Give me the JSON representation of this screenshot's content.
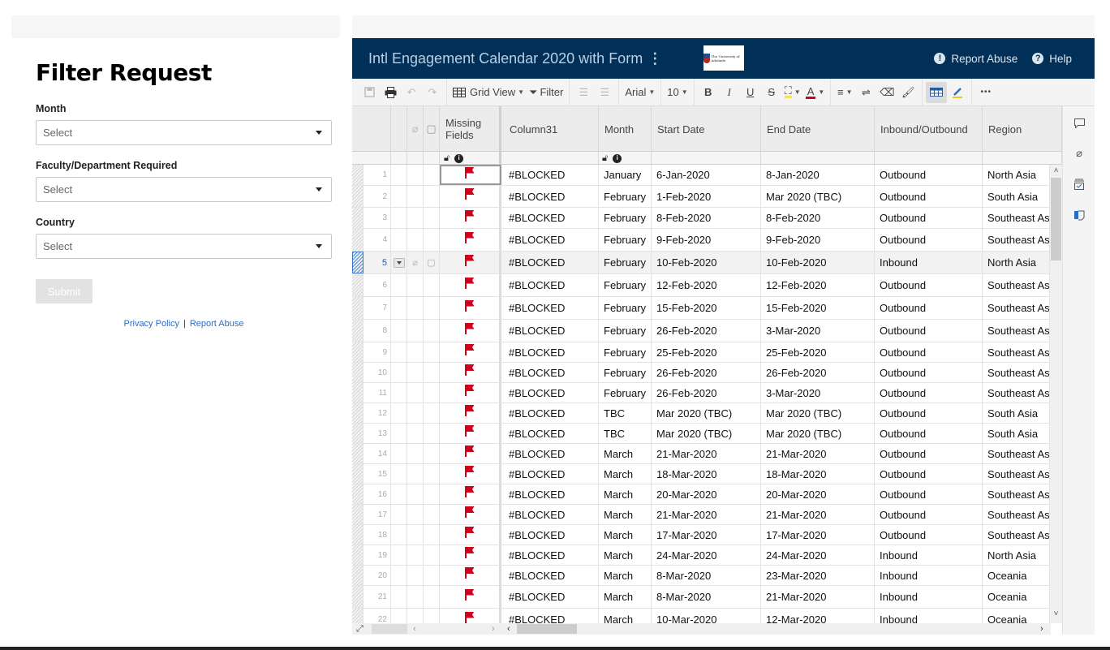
{
  "form": {
    "title": "Filter Request",
    "fields": [
      {
        "label": "Month",
        "placeholder": "Select"
      },
      {
        "label": "Faculty/Department Required",
        "placeholder": "Select"
      },
      {
        "label": "Country",
        "placeholder": "Select"
      }
    ],
    "submit_label": "Submit",
    "footer": {
      "privacy": "Privacy Policy",
      "separator": "|",
      "report": "Report Abuse"
    }
  },
  "sheet": {
    "title": "Intl Engagement Calendar 2020 with Form",
    "logo_alt": "The University of Adelaide",
    "header_links": {
      "report": "Report Abuse",
      "help": "Help"
    },
    "toolbar": {
      "view": "Grid View",
      "filter": "Filter",
      "font": "Arial",
      "font_size": "10",
      "bold": "B",
      "italic": "I",
      "underline": "U",
      "strike": "S",
      "more": "•••"
    },
    "columns": {
      "missing": "Missing Fields",
      "col31": "Column31",
      "month": "Month",
      "start": "Start Date",
      "end": "End Date",
      "io": "Inbound/Outbound",
      "region": "Region"
    },
    "selected_row": 5,
    "rows": [
      {
        "n": "1",
        "c31": "#BLOCKED",
        "month": "January",
        "start": "6-Jan-2020",
        "end": "8-Jan-2020",
        "io": "Outbound",
        "region": "North Asia"
      },
      {
        "n": "2",
        "c31": "#BLOCKED",
        "month": "February",
        "start": "1-Feb-2020",
        "end": "Mar 2020 (TBC)",
        "io": "Outbound",
        "region": "South Asia"
      },
      {
        "n": "3",
        "c31": "#BLOCKED",
        "month": "February",
        "start": "8-Feb-2020",
        "end": "8-Feb-2020",
        "io": "Outbound",
        "region": "Southeast Asia"
      },
      {
        "n": "4",
        "c31": "#BLOCKED",
        "month": "February",
        "start": "9-Feb-2020",
        "end": "9-Feb-2020",
        "io": "Outbound",
        "region": "Southeast Asia"
      },
      {
        "n": "5",
        "c31": "#BLOCKED",
        "month": "February",
        "start": "10-Feb-2020",
        "end": "10-Feb-2020",
        "io": "Inbound",
        "region": "North Asia"
      },
      {
        "n": "6",
        "c31": "#BLOCKED",
        "month": "February",
        "start": "12-Feb-2020",
        "end": "12-Feb-2020",
        "io": "Outbound",
        "region": "Southeast Asia"
      },
      {
        "n": "7",
        "c31": "#BLOCKED",
        "month": "February",
        "start": "15-Feb-2020",
        "end": "15-Feb-2020",
        "io": "Outbound",
        "region": "Southeast Asia"
      },
      {
        "n": "8",
        "c31": "#BLOCKED",
        "month": "February",
        "start": "26-Feb-2020",
        "end": "3-Mar-2020",
        "io": "Outbound",
        "region": "Southeast Asia"
      },
      {
        "n": "9",
        "c31": "#BLOCKED",
        "month": "February",
        "start": "25-Feb-2020",
        "end": "25-Feb-2020",
        "io": "Outbound",
        "region": "Southeast Asia"
      },
      {
        "n": "10",
        "c31": "#BLOCKED",
        "month": "February",
        "start": "26-Feb-2020",
        "end": "26-Feb-2020",
        "io": "Outbound",
        "region": "Southeast Asia"
      },
      {
        "n": "11",
        "c31": "#BLOCKED",
        "month": "February",
        "start": "26-Feb-2020",
        "end": "3-Mar-2020",
        "io": "Outbound",
        "region": "Southeast Asia"
      },
      {
        "n": "12",
        "c31": "#BLOCKED",
        "month": "TBC",
        "start": "Mar 2020 (TBC)",
        "end": "Mar 2020 (TBC)",
        "io": "Outbound",
        "region": "South Asia"
      },
      {
        "n": "13",
        "c31": "#BLOCKED",
        "month": "TBC",
        "start": "Mar 2020 (TBC)",
        "end": "Mar 2020 (TBC)",
        "io": "Outbound",
        "region": "South Asia"
      },
      {
        "n": "14",
        "c31": "#BLOCKED",
        "month": "March",
        "start": "21-Mar-2020",
        "end": "21-Mar-2020",
        "io": "Outbound",
        "region": "Southeast Asia"
      },
      {
        "n": "15",
        "c31": "#BLOCKED",
        "month": "March",
        "start": "18-Mar-2020",
        "end": "18-Mar-2020",
        "io": "Outbound",
        "region": "Southeast Asia"
      },
      {
        "n": "16",
        "c31": "#BLOCKED",
        "month": "March",
        "start": "20-Mar-2020",
        "end": "20-Mar-2020",
        "io": "Outbound",
        "region": "Southeast Asia"
      },
      {
        "n": "17",
        "c31": "#BLOCKED",
        "month": "March",
        "start": "21-Mar-2020",
        "end": "21-Mar-2020",
        "io": "Outbound",
        "region": "Southeast Asia"
      },
      {
        "n": "18",
        "c31": "#BLOCKED",
        "month": "March",
        "start": "17-Mar-2020",
        "end": "17-Mar-2020",
        "io": "Outbound",
        "region": "Southeast Asia"
      },
      {
        "n": "19",
        "c31": "#BLOCKED",
        "month": "March",
        "start": "24-Mar-2020",
        "end": "24-Mar-2020",
        "io": "Inbound",
        "region": "North Asia"
      },
      {
        "n": "20",
        "c31": "#BLOCKED",
        "month": "March",
        "start": "8-Mar-2020",
        "end": "23-Mar-2020",
        "io": "Inbound",
        "region": "Oceania"
      },
      {
        "n": "21",
        "c31": "#BLOCKED",
        "month": "March",
        "start": "8-Mar-2020",
        "end": "21-Mar-2020",
        "io": "Inbound",
        "region": "Oceania"
      },
      {
        "n": "22",
        "c31": "#BLOCKED",
        "month": "March",
        "start": "10-Mar-2020",
        "end": "12-Mar-2020",
        "io": "Inbound",
        "region": "Oceania"
      }
    ]
  },
  "colors": {
    "header_bg": "#003057",
    "flag": "#d0021b",
    "link": "#2a6dc9"
  }
}
